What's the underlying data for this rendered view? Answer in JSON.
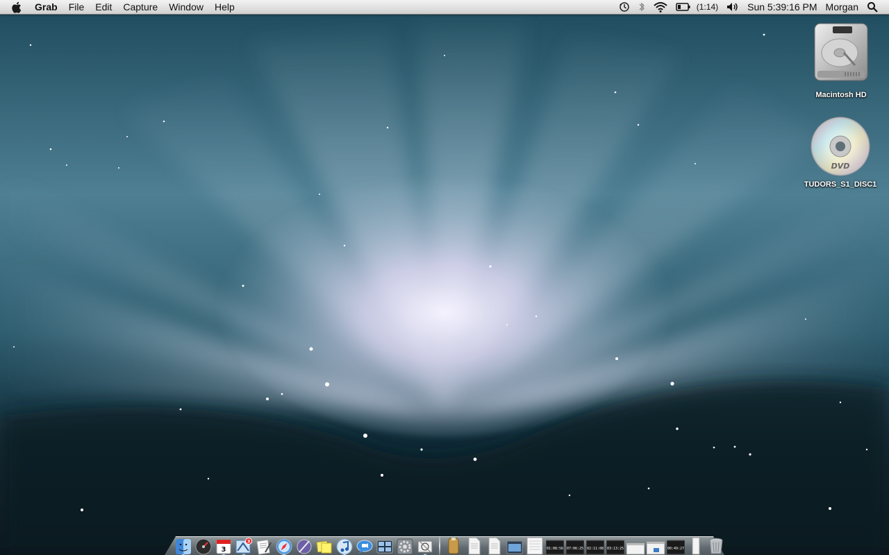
{
  "menubar": {
    "app_name": "Grab",
    "menus": [
      "File",
      "Edit",
      "Capture",
      "Window",
      "Help"
    ],
    "battery_time": "(1:14)",
    "clock": "Sun 5:39:16 PM",
    "user": "Morgan",
    "status_icons": [
      "time-machine-icon",
      "bluetooth-icon",
      "wifi-icon",
      "battery-icon",
      "volume-icon",
      "spotlight-icon"
    ]
  },
  "desktop": {
    "icons": [
      {
        "label": "Macintosh HD",
        "icon": "hard-drive-icon"
      },
      {
        "label": "TUDORS_S1_DISC1",
        "icon": "dvd-disc-icon"
      }
    ]
  },
  "dock": {
    "apps": [
      "finder-icon",
      "dashboard-icon",
      "ical-icon",
      "mail-icon",
      "textedit-icon",
      "safari-icon",
      "script-editor-icon",
      "stickies-icon",
      "itunes-icon",
      "ichat-icon",
      "spaces-icon",
      "system-preferences-icon",
      "grab-icon"
    ],
    "mail_badge": "3",
    "calendar_day": "3",
    "minimized_times": [
      "01:08:56",
      "07:06:25",
      "02:11:08",
      "03:13:25",
      "00:49:27"
    ]
  },
  "colors": {
    "menubar_top": "#f3f3f3",
    "menubar_bottom": "#cfcfcf",
    "wallpaper_dark": "#0c2530",
    "wallpaper_glow": "#e9e6f6"
  }
}
